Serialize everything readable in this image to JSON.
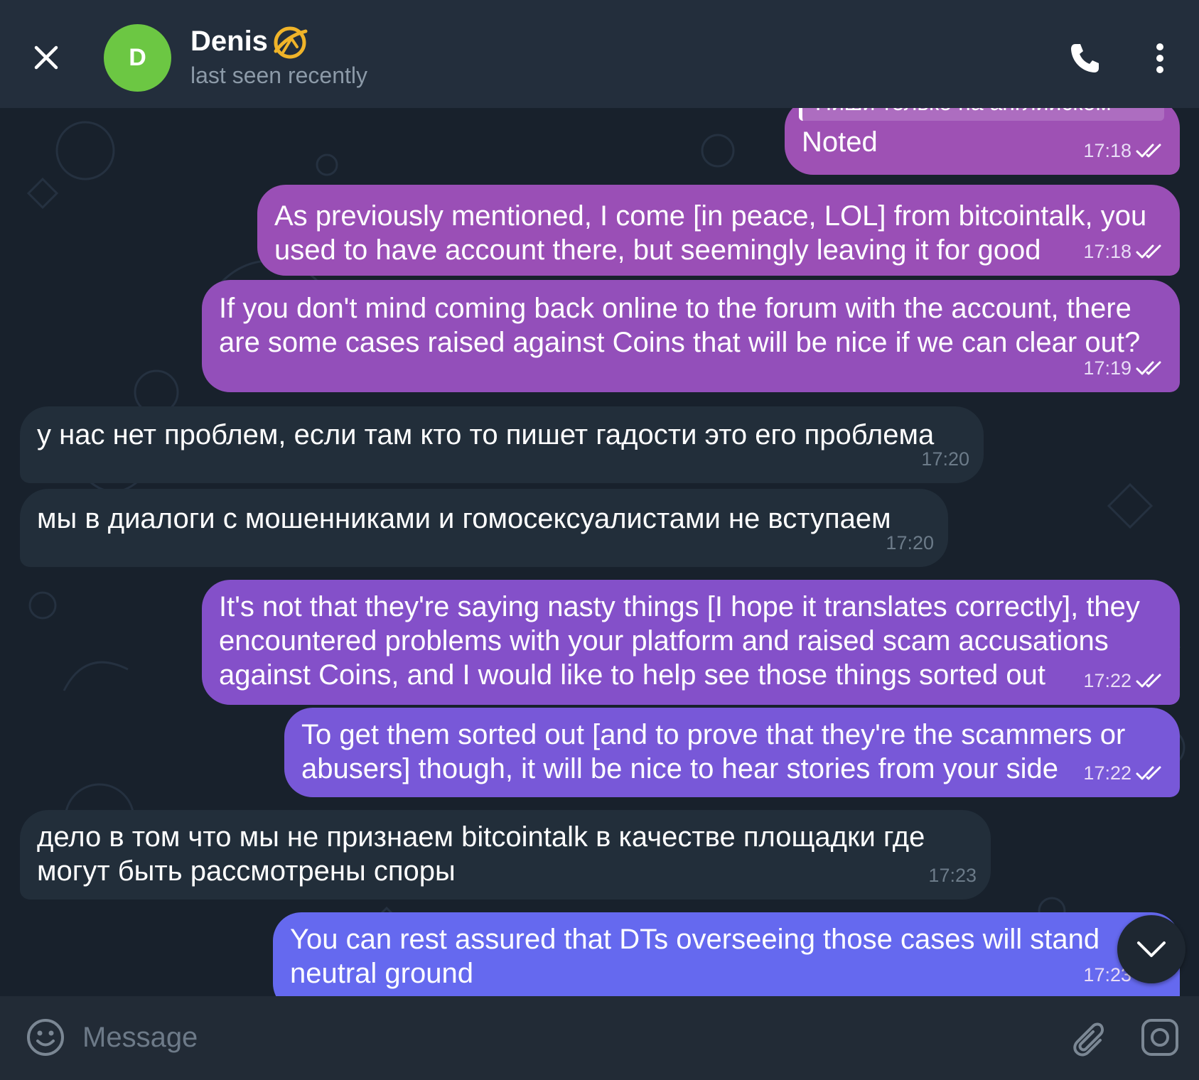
{
  "header": {
    "avatar_letter": "D",
    "name": "Denis",
    "status": "last seen recently",
    "avatar_color": "#6cc743",
    "badge_color": "#f0b429"
  },
  "icons": {
    "close": "close-icon",
    "call": "phone-icon",
    "menu": "more-vertical-icon",
    "badge": "premium-badge-icon",
    "emoji": "emoji-icon",
    "attach": "paperclip-icon",
    "camera": "camera-icon",
    "scroll_down": "chevron-down-icon",
    "read": "double-check-icon"
  },
  "theme": {
    "header_bg": "#232e3c",
    "chat_bg": "#18212c",
    "incoming_bubble": "#222e3a",
    "outgoing_gradient_top": "#a44fb0",
    "outgoing_gradient_bottom": "#6366ef"
  },
  "messages": [
    {
      "direction": "out",
      "reply_preview": "Пиши только на английском",
      "text": "Noted",
      "time": "17:18",
      "read": true
    },
    {
      "direction": "out",
      "text": "As previously mentioned, I come [in peace, LOL] from bitcointalk, you\nused to have account there, but seemingly leaving it for good",
      "time": "17:18",
      "read": true
    },
    {
      "direction": "out",
      "text": "If you don't mind coming back online to the forum with the account, there\nare some cases raised against Coins that will be nice if we can clear out?",
      "time": "17:19",
      "read": true
    },
    {
      "direction": "in",
      "text": "у нас нет проблем, если там кто то пишет гадости это его проблема",
      "time": "17:20"
    },
    {
      "direction": "in",
      "text": "мы в диалоги с мошенниками и гомосексуалистами не вступаем",
      "time": "17:20"
    },
    {
      "direction": "out",
      "text": "It's not that they're saying nasty things [I hope it translates correctly], they\nencountered problems with your platform and raised scam accusations\nagainst Coins, and I would like to help see those things sorted out",
      "time": "17:22",
      "read": true
    },
    {
      "direction": "out",
      "text": "To get them sorted out [and to prove that they're the scammers or\nabusers] though, it will be nice to hear stories from your side",
      "time": "17:22",
      "read": true
    },
    {
      "direction": "in",
      "text": "дело в том что мы не признаем bitcointalk в качестве площадки где\nмогут быть рассмотрены споры",
      "time": "17:23"
    },
    {
      "direction": "out",
      "text": "You can rest assured that DTs overseeing those cases will stand\nneutral ground",
      "time": "17:23",
      "read": true
    }
  ],
  "composer": {
    "placeholder": "Message",
    "value": ""
  }
}
